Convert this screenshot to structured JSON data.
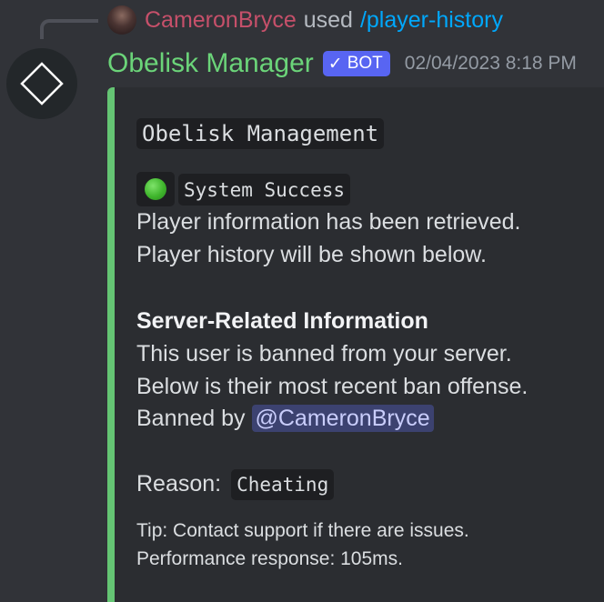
{
  "command": {
    "user": "CameronBryce",
    "used_text": "used",
    "command_name": "/player-history"
  },
  "message": {
    "author": "Obelisk Manager",
    "bot_tag": "BOT",
    "bot_check": "✓",
    "timestamp": "02/04/2023 8:18 PM",
    "avatar_icon": "diamond-icon"
  },
  "embed": {
    "accent_color": "#65c574",
    "title": "Obelisk Management",
    "status_emoji": "green-circle",
    "status_text": "System Success",
    "desc_line1": "Player information has been retrieved.",
    "desc_line2": "Player history will be shown below.",
    "section_title": "Server-Related Information",
    "section_line1": "This user is banned from your server.",
    "section_line2": "Below is their most recent ban offense.",
    "banned_by_label": "Banned by",
    "banned_by_mention": "@CameronBryce",
    "reason_label": "Reason:",
    "reason_value": "Cheating",
    "tip": "Tip: Contact support if there are issues.",
    "performance": "Performance response: 105ms."
  },
  "colors": {
    "background": "#313338",
    "author": "#6bd479",
    "command_user": "#c6506a",
    "command_link": "#00a8fc",
    "bot_tag": "#5865f2"
  }
}
